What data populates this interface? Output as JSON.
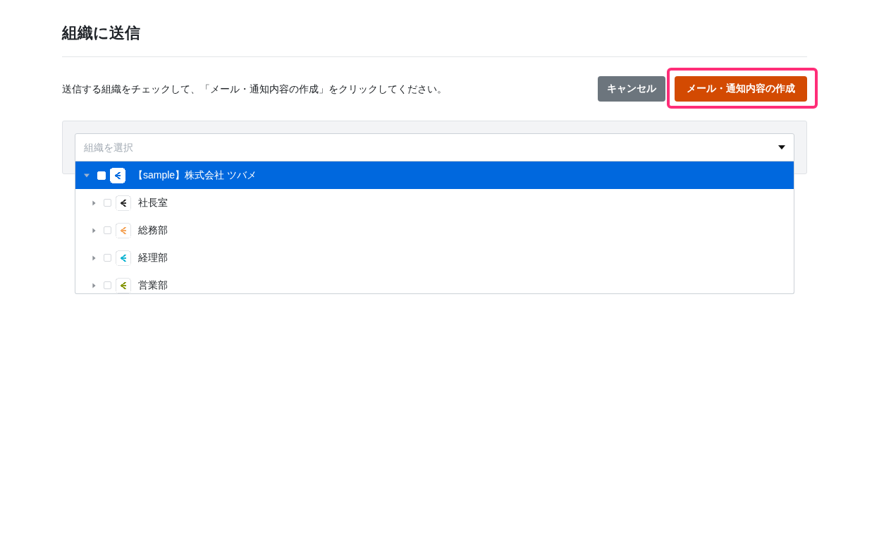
{
  "page": {
    "title": "組織に送信",
    "instruction": "送信する組織をチェックして、「メール・通知内容の作成」をクリックしてください。"
  },
  "buttons": [
    {
      "label": "キャンセル",
      "kind": "secondary",
      "highlighted": false
    },
    {
      "label": "メール・通知内容の作成",
      "kind": "primary",
      "highlighted": true
    }
  ],
  "org_select": {
    "placeholder": "組織を選択",
    "expanded": true,
    "tree": [
      {
        "label": "【sample】株式会社 ツバメ",
        "selected": true,
        "checked": false,
        "expanded": true,
        "color": "#0a6ee0",
        "children": [
          {
            "label": "社長室",
            "selected": false,
            "checked": false,
            "expanded": false,
            "color": "#333333"
          },
          {
            "label": "総務部",
            "selected": false,
            "checked": false,
            "expanded": false,
            "color": "#f5a860"
          },
          {
            "label": "経理部",
            "selected": false,
            "checked": false,
            "expanded": false,
            "color": "#17b6d3"
          },
          {
            "label": "営業部",
            "selected": false,
            "checked": false,
            "expanded": false,
            "color": "#8a9a14"
          }
        ]
      }
    ]
  }
}
